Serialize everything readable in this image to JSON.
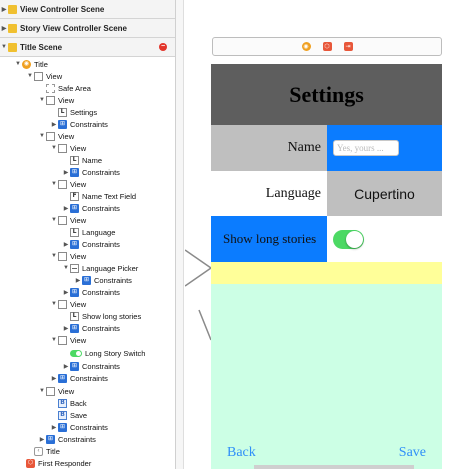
{
  "outline": {
    "sections": [
      {
        "label": "View Controller Scene"
      },
      {
        "label": "Story View Controller Scene"
      },
      {
        "label": "Title Scene"
      }
    ],
    "rows": [
      {
        "label": "Title",
        "icon": "view-controller-icon"
      },
      {
        "label": "View",
        "icon": "view-icon"
      },
      {
        "label": "Safe Area",
        "icon": "safe-area-icon"
      },
      {
        "label": "View",
        "icon": "view-icon"
      },
      {
        "label": "Settings",
        "icon": "label-icon"
      },
      {
        "label": "Constraints",
        "icon": "constraints-icon"
      },
      {
        "label": "View",
        "icon": "view-icon"
      },
      {
        "label": "View",
        "icon": "view-icon"
      },
      {
        "label": "Name",
        "icon": "label-icon"
      },
      {
        "label": "Constraints",
        "icon": "constraints-icon"
      },
      {
        "label": "View",
        "icon": "view-icon"
      },
      {
        "label": "Name Text Field",
        "icon": "text-field-icon"
      },
      {
        "label": "Constraints",
        "icon": "constraints-icon"
      },
      {
        "label": "View",
        "icon": "view-icon"
      },
      {
        "label": "Language",
        "icon": "label-icon"
      },
      {
        "label": "Constraints",
        "icon": "constraints-icon"
      },
      {
        "label": "View",
        "icon": "view-icon"
      },
      {
        "label": "Language Picker",
        "icon": "picker-icon"
      },
      {
        "label": "Constraints",
        "icon": "constraints-icon"
      },
      {
        "label": "Constraints",
        "icon": "constraints-icon"
      },
      {
        "label": "View",
        "icon": "view-icon"
      },
      {
        "label": "Show long stories",
        "icon": "label-icon"
      },
      {
        "label": "Constraints",
        "icon": "constraints-icon"
      },
      {
        "label": "View",
        "icon": "view-icon"
      },
      {
        "label": "Long Story Switch",
        "icon": "switch-icon"
      },
      {
        "label": "Constraints",
        "icon": "constraints-icon"
      },
      {
        "label": "Constraints",
        "icon": "constraints-icon"
      },
      {
        "label": "View",
        "icon": "view-icon"
      },
      {
        "label": "Back",
        "icon": "button-icon"
      },
      {
        "label": "Save",
        "icon": "button-icon"
      },
      {
        "label": "Constraints",
        "icon": "constraints-icon"
      },
      {
        "label": "Constraints",
        "icon": "constraints-icon"
      },
      {
        "label": "Title",
        "icon": "exit-icon"
      },
      {
        "label": "First Responder",
        "icon": "first-responder-icon"
      }
    ]
  },
  "canvas": {
    "title": "Settings",
    "name_label": "Name",
    "name_placeholder": "Yes, yours ...",
    "language_label": "Language",
    "language_value": "Cupertino",
    "story_label": "Show long stories",
    "back_label": "Back",
    "save_label": "Save"
  },
  "colors": {
    "title_bar": "#5e5e5e",
    "blue_cell": "#0b7cff",
    "gray_cell": "#bfbfbf",
    "yellow_strip": "#ffff99",
    "mint_background": "#ccffe5",
    "switch_on": "#4cd964",
    "button_text": "#2f8ff8"
  }
}
